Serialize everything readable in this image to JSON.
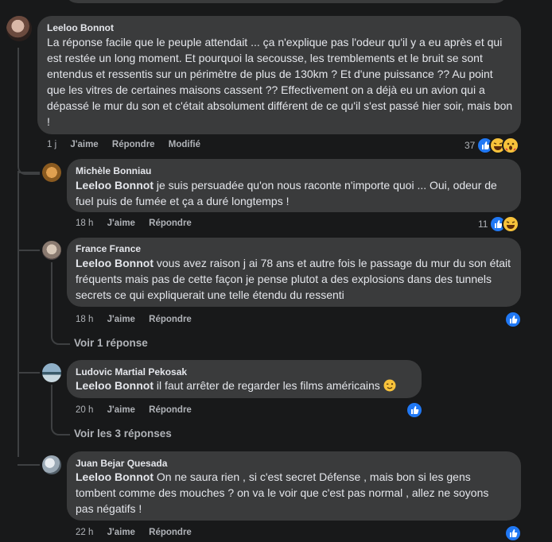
{
  "comments": [
    {
      "author": "Leeloo Bonnot",
      "mention": "",
      "text": "La réponse facile que le peuple attendait ... ça n'explique pas l'odeur qu'il y a eu après et qui est restée un long moment. Et pourquoi la secousse, les tremblements et le bruit se sont entendus et ressentis sur un périmètre de plus de 130km ? Et d'une puissance ?? Au point que les vitres de certaines maisons cassent ?? Effectivement on a déjà eu un avion qui a dépassé le mur du son et c'était absolument différent de ce qu'il s'est passé hier soir, mais bon !",
      "time": "1 j",
      "like": "J'aime",
      "reply": "Répondre",
      "edited": "Modifié",
      "reaction_count": "37",
      "reactions": [
        "like-icon",
        "laugh-icon",
        "wow-icon"
      ]
    },
    {
      "author": "Michèle Bonniau",
      "mention": "Leeloo Bonnot",
      "text": " je suis persuadée qu'on nous raconte n'importe quoi ... Oui, odeur de fuel puis de fumée et ça a duré longtemps !",
      "time": "18 h",
      "like": "J'aime",
      "reply": "Répondre",
      "reaction_count": "11",
      "reactions": [
        "like-icon",
        "laugh-icon"
      ]
    },
    {
      "author": "France France",
      "mention": "Leeloo Bonnot",
      "text": " vous avez raison j ai 78 ans et autre fois le passage du mur du son était fréquents mais pas de cette façon je pense plutot a des explosions dans des tunnels secrets ce qui expliquerait une telle étendu du ressenti",
      "time": "18 h",
      "like": "J'aime",
      "reply": "Répondre",
      "reaction_count": "",
      "reactions": [
        "like-icon"
      ],
      "view_replies": "Voir 1 réponse"
    },
    {
      "author": "Ludovic Martial Pekosak",
      "mention": "Leeloo Bonnot",
      "text": " il faut arrêter de regarder les films américains ",
      "emoji": "wink-emoji",
      "time": "20 h",
      "like": "J'aime",
      "reply": "Répondre",
      "reaction_count": "",
      "reactions": [
        "like-icon"
      ],
      "view_replies": "Voir les 3 réponses"
    },
    {
      "author": "Juan Bejar Quesada",
      "mention": "Leeloo Bonnot",
      "text": " On ne saura rien , si c'est secret Défense , mais bon si les gens tombent comme des mouches ? on va le voir que c'est pas normal , allez ne soyons pas négatifs !",
      "time": "22 h",
      "like": "J'aime",
      "reply": "Répondre",
      "reaction_count": "",
      "reactions": [
        "like-icon"
      ]
    }
  ],
  "colors": {
    "background": "#18191a",
    "bubble": "#3a3b3c",
    "text": "#e4e6eb",
    "muted": "#b0b3b8",
    "like_blue": "#2078f4"
  }
}
